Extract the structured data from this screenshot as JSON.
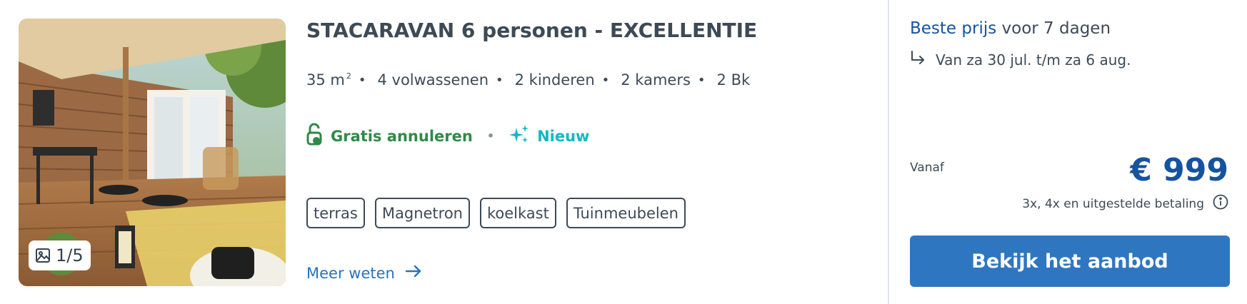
{
  "listing": {
    "title": "STACARAVAN 6 personen - EXCELLENTIE",
    "photo": {
      "counter": "1/5",
      "icon": "image-icon"
    },
    "specs": {
      "area": "35 m",
      "area_unit_sup": "2",
      "adults": "4 volwassenen",
      "children": "2 kinderen",
      "rooms": "2 kamers",
      "bathrooms": "2 Bk"
    },
    "features": {
      "cancel_label": "Gratis annuleren",
      "cancel_icon": "unlock-icon",
      "new_label": "Nieuw",
      "new_icon": "sparkles-icon"
    },
    "tags": [
      "terras",
      "Magnetron",
      "koelkast",
      "Tuinmeubelen"
    ],
    "more_link": "Meer weten"
  },
  "pricing": {
    "best_strong": "Beste prijs",
    "best_rest": " voor 7 dagen",
    "dates": "Van za 30 jul. t/m za 6 aug.",
    "from_label": "Vanaf",
    "price": "€ 999",
    "payment_note": "3x, 4x en uitgestelde betaling",
    "cta_label": "Bekijk het aanbod"
  },
  "colors": {
    "brand_blue": "#15539e",
    "button_blue": "#2f76c1",
    "link_blue": "#2773bc",
    "green": "#2f8a47",
    "teal": "#14b8c4",
    "text": "#3d4a56"
  }
}
